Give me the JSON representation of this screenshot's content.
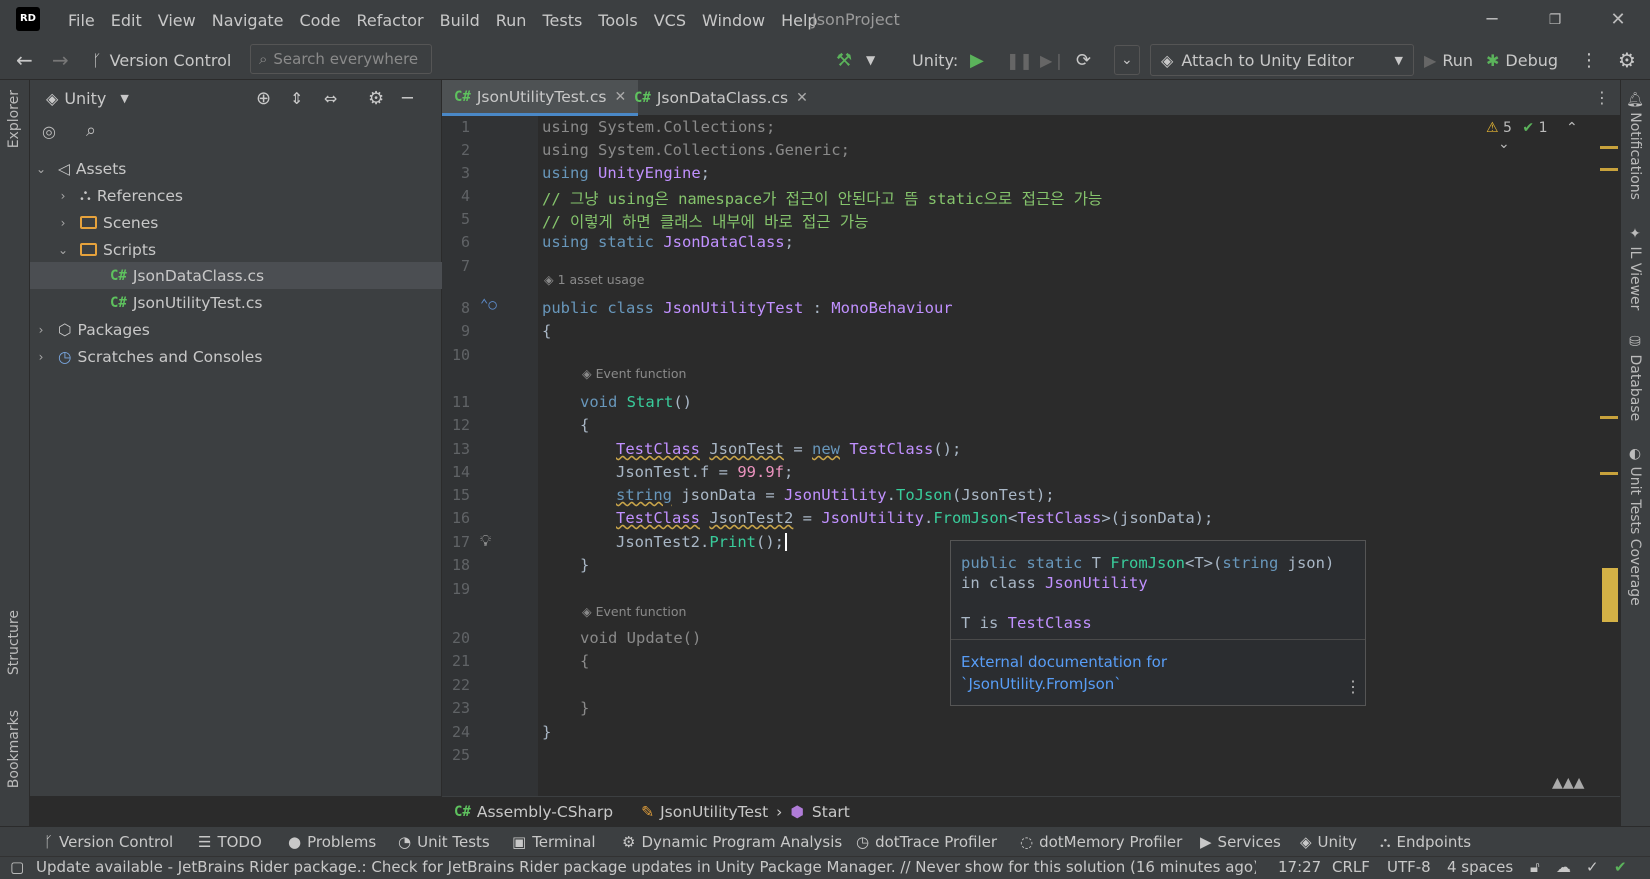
{
  "menu": [
    "File",
    "Edit",
    "View",
    "Navigate",
    "Code",
    "Refactor",
    "Build",
    "Run",
    "Tests",
    "Tools",
    "VCS",
    "Window",
    "Help"
  ],
  "app": {
    "logo": "RD",
    "project": "JsonProject"
  },
  "toolbar": {
    "vcs": "Version Control",
    "search_placeholder": "Search everywhere",
    "unity_label": "Unity:",
    "attach": "Attach to Unity Editor",
    "run": "Run",
    "debug": "Debug"
  },
  "left_strip": {
    "explorer": "Explorer",
    "structure": "Structure",
    "bookmarks": "Bookmarks"
  },
  "right_strip": {
    "notifications": "Notifications",
    "il_viewer": "IL Viewer",
    "database": "Database",
    "unit_tests": "Unit Tests Coverage"
  },
  "explorer": {
    "title": "Unity",
    "tree": [
      {
        "label": "Assets",
        "arrow": "⌄"
      },
      {
        "label": "References",
        "arrow": "›"
      },
      {
        "label": "Scenes",
        "arrow": "›"
      },
      {
        "label": "Scripts",
        "arrow": "⌄"
      },
      {
        "label": "JsonDataClass.cs",
        "arrow": ""
      },
      {
        "label": "JsonUtilityTest.cs",
        "arrow": ""
      },
      {
        "label": "Packages",
        "arrow": "›"
      },
      {
        "label": "Scratches and Consoles",
        "arrow": "›"
      }
    ]
  },
  "tabs": [
    {
      "label": "JsonUtilityTest.cs",
      "icon": "C#"
    },
    {
      "label": "JsonDataClass.cs",
      "icon": "C#"
    }
  ],
  "inspections": {
    "warnings": "5",
    "ok": "1"
  },
  "hints": {
    "usage": "1 asset usage",
    "event": "Event function"
  },
  "code": {
    "l1": "using System.Collections;",
    "l2": "using System.Collections.Generic;",
    "l3a": "using",
    "l3b": " UnityEngine",
    "l3c": ";",
    "l4": "// 그냥 using은 namespace가 접근이 안된다고 뜸 static으로 접근은 가능",
    "l5": "// 이렇게 하면 클래스 내부에 바로 접근 가능",
    "l6a": "using static",
    "l6b": " JsonDataClass",
    "l6c": ";",
    "l8a": "public class",
    "l8b": " JsonUtilityTest",
    "l8c": " : ",
    "l8d": "MonoBehaviour",
    "l9": "{",
    "l11a": "void",
    "l11b": " Start",
    "l11c": "()",
    "l12": "{",
    "l13a": "TestClass",
    "l13b": "JsonTest",
    "l13c": " = ",
    "l13d": "new",
    "l13e": " TestClass",
    "l13f": "();",
    "l14a": "JsonTest.f = ",
    "l14b": "99.9f",
    "l14c": ";",
    "l15a": "string",
    "l15b": " jsonData = ",
    "l15c": "JsonUtility",
    "l15d": ".",
    "l15e": "ToJson",
    "l15f": "(JsonTest);",
    "l16a": "TestClass",
    "l16b": "JsonTest2",
    "l16c": " = ",
    "l16d": "JsonUtility",
    "l16e": ".",
    "l16f": "FromJson",
    "l16g": "<",
    "l16h": "TestClass",
    "l16i": ">(jsonData);",
    "l17a": "JsonTest2.",
    "l17b": "Print",
    "l17c": "();",
    "l18": "}",
    "l20": "void Update()",
    "l21": "{",
    "l23": "}",
    "l24": "}"
  },
  "popup": {
    "sig1a": "public static",
    "sig1b": " T ",
    "sig1c": "FromJson",
    "sig1d": "<T>(",
    "sig1e": "string",
    "sig1f": " json)",
    "sig2a": "in class ",
    "sig2b": "JsonUtility",
    "sig3a": "T is ",
    "sig3b": "TestClass",
    "doc1": "External documentation for",
    "doc2": "`JsonUtility.FromJson`"
  },
  "crumbs": {
    "assembly": "Assembly-CSharp",
    "cls": "JsonUtilityTest",
    "method": "Start"
  },
  "tooltabs": [
    "Version Control",
    "TODO",
    "Problems",
    "Unit Tests",
    "Terminal",
    "Dynamic Program Analysis",
    "dotTrace Profiler",
    "dotMemory Profiler",
    "Services",
    "Unity",
    "Endpoints"
  ],
  "status": {
    "message": "Update available - JetBrains Rider package.: Check for JetBrains Rider package updates in Unity Package Manager. // Never show for this solution (16 minutes ago)",
    "position": "17:27",
    "eol": "CRLF",
    "encoding": "UTF-8",
    "indent": "4 spaces"
  }
}
